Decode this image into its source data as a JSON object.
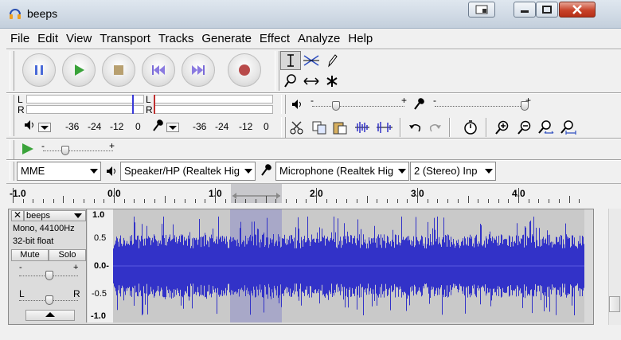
{
  "window": {
    "title": "beeps"
  },
  "menu": [
    "File",
    "Edit",
    "View",
    "Transport",
    "Tracks",
    "Generate",
    "Effect",
    "Analyze",
    "Help"
  ],
  "meter": {
    "channel_l": "L",
    "channel_r": "R",
    "scale": [
      "-36",
      "-24",
      "-12",
      "0"
    ],
    "scale_right": [
      "-36",
      "-24",
      "-12",
      "0"
    ]
  },
  "slider_marks": {
    "minus": "-",
    "plus": "+"
  },
  "device": {
    "host": "MME",
    "output": "Speaker/HP (Realtek Hig",
    "input": "Microphone (Realtek Hig",
    "channels": "2 (Stereo) Inp"
  },
  "timeline": {
    "labels": [
      "-1.0",
      "0.0",
      "1.0",
      "2.0",
      "3.0",
      "4.0"
    ]
  },
  "track": {
    "name": "beeps",
    "format": "Mono, 44100Hz",
    "bit_depth": "32-bit float",
    "mute_label": "Mute",
    "solo_label": "Solo",
    "pan_left": "L",
    "pan_right": "R",
    "vruler": [
      "1.0",
      "0.5",
      "0.0-",
      "-0.5",
      "-1.0"
    ]
  },
  "colors": {
    "waveform": "#3232c8",
    "selection": "#a8a8c8",
    "play_green": "#3aa33a",
    "record_red": "#b84a4a",
    "pause_blue": "#4a6ad8"
  },
  "icons": {
    "pause": "pause-icon",
    "play": "play-icon",
    "stop": "stop-icon",
    "skip_start": "skip-start-icon",
    "skip_end": "skip-end-icon",
    "record": "record-icon"
  }
}
